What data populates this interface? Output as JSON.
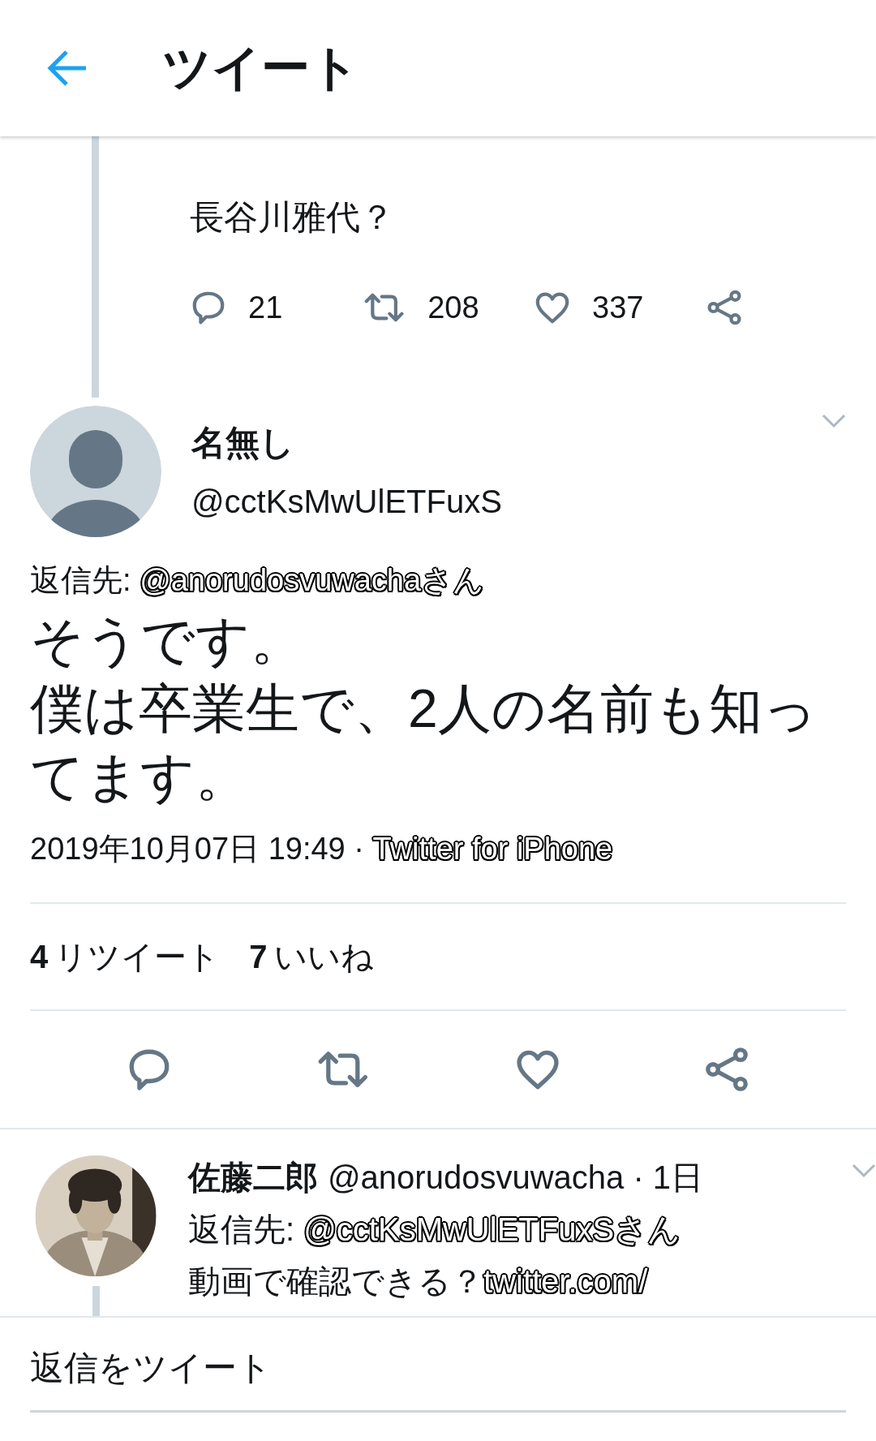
{
  "header": {
    "title": "ツイート"
  },
  "parent_tweet": {
    "text": "長谷川雅代？",
    "actions": [
      {
        "kind": "reply",
        "count": "21"
      },
      {
        "kind": "retweet",
        "count": "208"
      },
      {
        "kind": "like",
        "count": "337"
      },
      {
        "kind": "share"
      }
    ]
  },
  "tweet": {
    "name": "名無し",
    "handle": "@cctKsMwUlETFuxS",
    "reply_to": {
      "label": "返信先:",
      "handle": "@anorudosvuwachaさん"
    },
    "lines": [
      "そうです。",
      "僕は卒業生で、2人の名前も知ってます。"
    ],
    "timestamp": "2019年10月07日 19:49",
    "separator": "·",
    "source": "Twitter for iPhone",
    "stats": [
      {
        "count": "4",
        "label": "リツイート"
      },
      {
        "count": "7",
        "label": "いいね"
      }
    ],
    "actions": [
      {
        "kind": "reply"
      },
      {
        "kind": "retweet"
      },
      {
        "kind": "like"
      },
      {
        "kind": "share"
      }
    ]
  },
  "reply": {
    "name": "佐藤二郎",
    "handle": "@anorudosvuwacha",
    "separator": "·",
    "time": "1日",
    "reply_to": {
      "label": "返信先:",
      "handle": "@cctKsMwUlETFuxSさん"
    },
    "text": "動画で確認できる？",
    "link": "twitter.com/"
  },
  "compose": {
    "placeholder": "返信をツイート"
  }
}
